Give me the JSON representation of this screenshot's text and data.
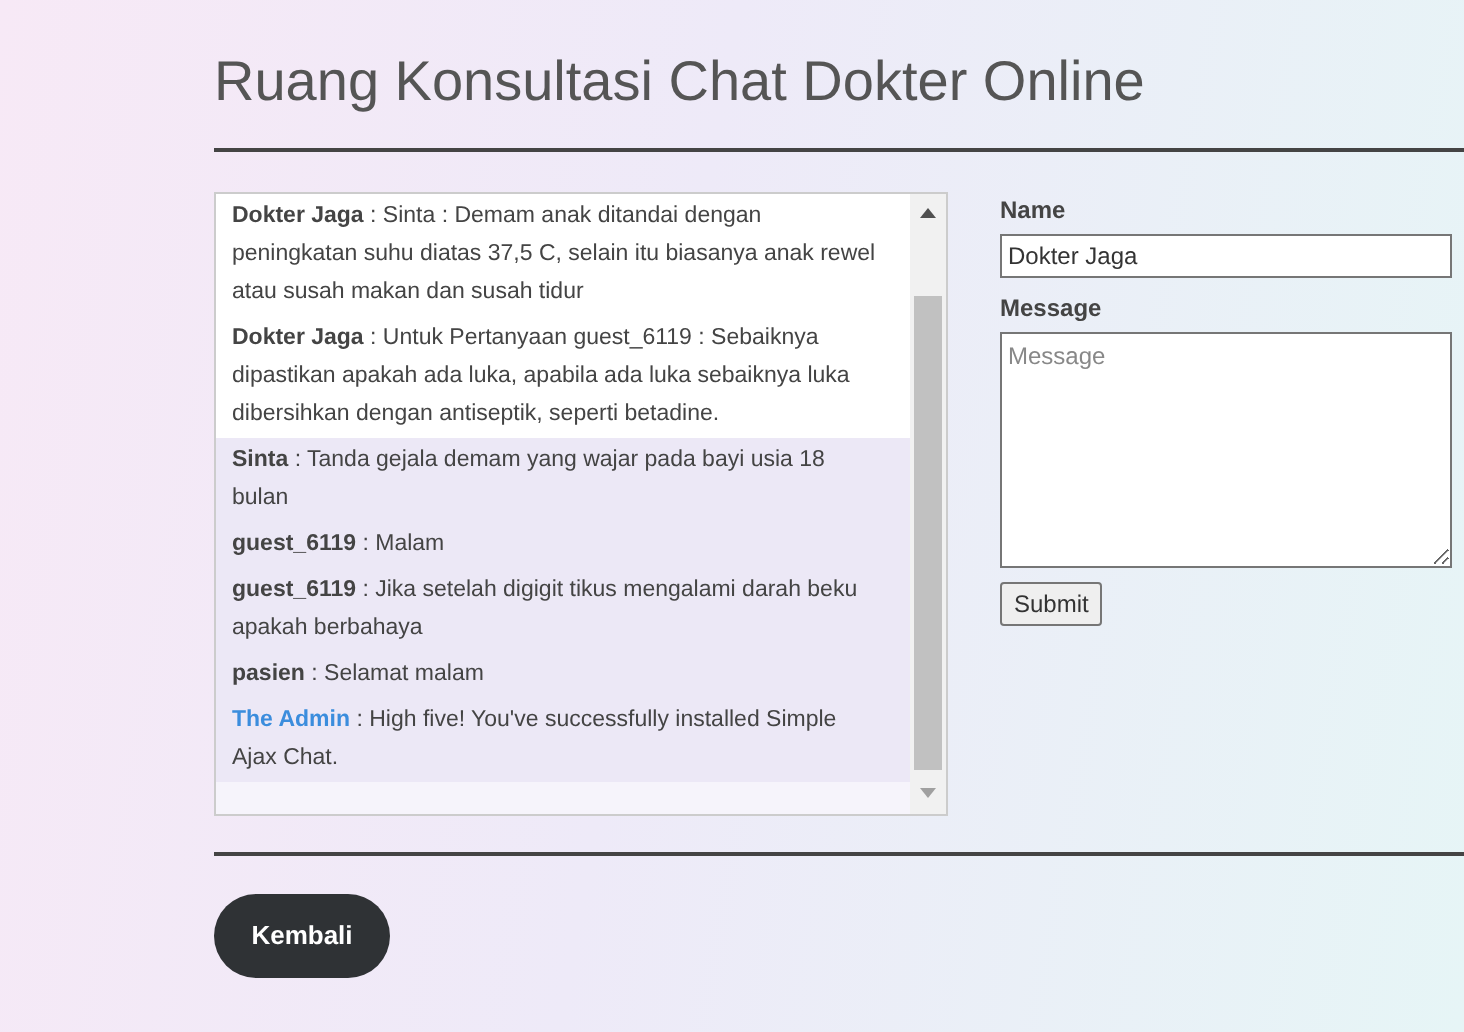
{
  "title": "Ruang Konsultasi Chat Dokter Online",
  "messages": [
    {
      "author": "Dokter Jaga",
      "text": ": Sinta : Demam anak ditandai dengan peningkatan suhu diatas 37,5 C, selain itu biasanya anak rewel atau susah makan dan susah tidur",
      "highlighted": true,
      "color": "#444444"
    },
    {
      "author": "Dokter Jaga",
      "text": ": Untuk Pertanyaan guest_6119 : Sebaiknya dipastikan apakah ada luka, apabila ada luka sebaiknya luka dibersihkan dengan antiseptik, seperti betadine.",
      "highlighted": true,
      "color": "#444444"
    },
    {
      "author": "Sinta",
      "text": ": Tanda gejala demam yang wajar pada bayi usia 18 bulan",
      "highlighted": false,
      "color": "#444444"
    },
    {
      "author": "guest_6119",
      "text": ": Malam",
      "highlighted": false,
      "color": "#444444"
    },
    {
      "author": "guest_6119",
      "text": ": Jika setelah digigit tikus mengalami darah beku apakah berbahaya",
      "highlighted": false,
      "color": "#444444"
    },
    {
      "author": "pasien",
      "text": ": Selamat malam",
      "highlighted": false,
      "color": "#444444"
    },
    {
      "author": "The Admin",
      "text": ": High five! You've successfully installed Simple Ajax Chat.",
      "highlighted": false,
      "color": "#3b8ddd"
    }
  ],
  "form": {
    "name_label": "Name",
    "name_value": "Dokter Jaga",
    "message_label": "Message",
    "message_placeholder": "Message",
    "submit": "Submit"
  },
  "back_button": "Kembali"
}
